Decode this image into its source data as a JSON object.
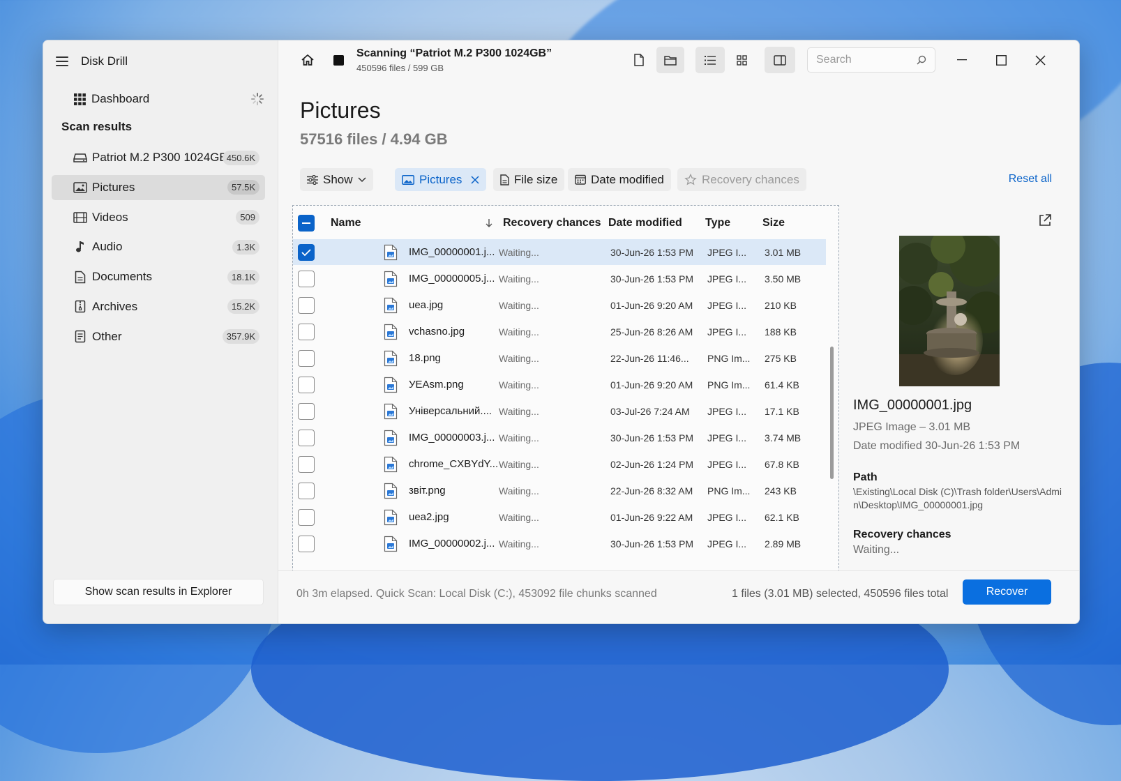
{
  "app": {
    "title": "Disk Drill"
  },
  "sidebar": {
    "dashboard_label": "Dashboard",
    "section_title": "Scan results",
    "items": [
      {
        "label": "Patriot M.2 P300 1024GB",
        "count": "450.6K",
        "icon": "drive-icon"
      },
      {
        "label": "Pictures",
        "count": "57.5K",
        "icon": "pictures-icon",
        "active": true
      },
      {
        "label": "Videos",
        "count": "509",
        "icon": "videos-icon"
      },
      {
        "label": "Audio",
        "count": "1.3K",
        "icon": "audio-icon"
      },
      {
        "label": "Documents",
        "count": "18.1K",
        "icon": "documents-icon"
      },
      {
        "label": "Archives",
        "count": "15.2K",
        "icon": "archives-icon"
      },
      {
        "label": "Other",
        "count": "357.9K",
        "icon": "other-icon"
      }
    ],
    "explorer_button": "Show scan results in Explorer"
  },
  "toolbar": {
    "scan_title": "Scanning “Patriot M.2 P300 1024GB”",
    "scan_subtitle": "450596 files / 599 GB",
    "search_placeholder": "Search"
  },
  "page": {
    "title": "Pictures",
    "subtitle": "57516 files / 4.94 GB"
  },
  "filters": {
    "show": "Show",
    "pictures": "Pictures",
    "file_size": "File size",
    "date_modified": "Date modified",
    "recovery_chances": "Recovery chances",
    "reset_all": "Reset all"
  },
  "table": {
    "columns": [
      "Name",
      "Recovery chances",
      "Date modified",
      "Type",
      "Size"
    ],
    "rows": [
      {
        "name": "IMG_00000001.j...",
        "recovery": "Waiting...",
        "date": "30-Jun-26 1:53 PM",
        "type": "JPEG I...",
        "size": "3.01 MB",
        "selected": true
      },
      {
        "name": "IMG_00000005.j...",
        "recovery": "Waiting...",
        "date": "30-Jun-26 1:53 PM",
        "type": "JPEG I...",
        "size": "3.50 MB"
      },
      {
        "name": "uea.jpg",
        "recovery": "Waiting...",
        "date": "01-Jun-26 9:20 AM",
        "type": "JPEG I...",
        "size": "210 KB"
      },
      {
        "name": "vchasno.jpg",
        "recovery": "Waiting...",
        "date": "25-Jun-26 8:26 AM",
        "type": "JPEG I...",
        "size": "188 KB"
      },
      {
        "name": "18.png",
        "recovery": "Waiting...",
        "date": "22-Jun-26 11:46...",
        "type": "PNG Im...",
        "size": "275 KB"
      },
      {
        "name": "УEAsm.png",
        "recovery": "Waiting...",
        "date": "01-Jun-26 9:20 AM",
        "type": "PNG Im...",
        "size": "61.4 KB"
      },
      {
        "name": "Універсальний....",
        "recovery": "Waiting...",
        "date": "03-Jul-26 7:24 AM",
        "type": "JPEG I...",
        "size": "17.1 KB"
      },
      {
        "name": "IMG_00000003.j...",
        "recovery": "Waiting...",
        "date": "30-Jun-26 1:53 PM",
        "type": "JPEG I...",
        "size": "3.74 MB"
      },
      {
        "name": "chrome_CXBYdY...",
        "recovery": "Waiting...",
        "date": "02-Jun-26 1:24 PM",
        "type": "JPEG I...",
        "size": "67.8 KB"
      },
      {
        "name": "звіт.png",
        "recovery": "Waiting...",
        "date": "22-Jun-26 8:32 AM",
        "type": "PNG Im...",
        "size": "243 KB"
      },
      {
        "name": "uea2.jpg",
        "recovery": "Waiting...",
        "date": "01-Jun-26 9:22 AM",
        "type": "JPEG I...",
        "size": "62.1 KB"
      },
      {
        "name": "IMG_00000002.j...",
        "recovery": "Waiting...",
        "date": "30-Jun-26 1:53 PM",
        "type": "JPEG I...",
        "size": "2.89 MB"
      }
    ]
  },
  "preview": {
    "file_name": "IMG_00000001.jpg",
    "type_size": "JPEG Image – 3.01 MB",
    "date_modified": "Date modified 30-Jun-26 1:53 PM",
    "path_label": "Path",
    "path": "\\Existing\\Local Disk (C)\\Trash folder\\Users\\Admin\\Desktop\\IMG_00000001.jpg",
    "recovery_label": "Recovery chances",
    "recovery_value": "Waiting..."
  },
  "status": {
    "left": "0h 3m elapsed. Quick Scan: Local Disk (C:), 453092 file chunks scanned",
    "right": "1 files (3.01 MB) selected, 450596 files total",
    "recover_button": "Recover"
  },
  "colors": {
    "accent": "#0a63c9",
    "recover_button": "#0a6fe0",
    "selected_row": "#dbe8f7"
  }
}
